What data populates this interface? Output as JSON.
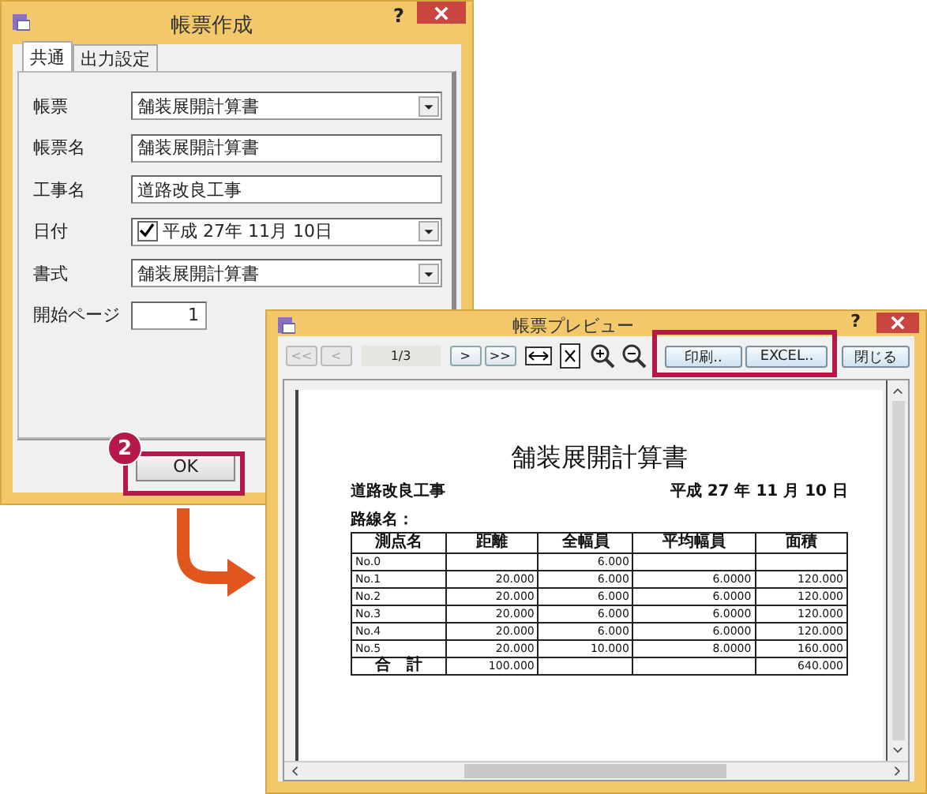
{
  "dialog": {
    "title": "帳票作成",
    "help": "?",
    "tabs": [
      {
        "label": "共通",
        "selected": true
      },
      {
        "label": "出力設定",
        "selected": false
      }
    ],
    "fields": [
      {
        "label": "帳票",
        "kind": "dropdown",
        "value": "舗装展開計算書"
      },
      {
        "label": "帳票名",
        "kind": "text",
        "value": "舗装展開計算書"
      },
      {
        "label": "工事名",
        "kind": "text",
        "value": "道路改良工事"
      },
      {
        "label": "日付",
        "kind": "date",
        "value": "平成 27年 11月 10日",
        "checked": true
      },
      {
        "label": "書式",
        "kind": "dropdown",
        "value": "舗装展開計算書"
      },
      {
        "label": "開始ページ",
        "kind": "number",
        "value": "1"
      }
    ],
    "ok_button": "OK",
    "step_badge": "2"
  },
  "preview": {
    "title": "帳票プレビュー",
    "help": "?",
    "nav_back": [
      {
        "label": "<<",
        "disabled": true
      },
      {
        "label": "<",
        "disabled": true
      }
    ],
    "page": "1/3",
    "nav_forward": [
      {
        "label": ">",
        "disabled": false
      },
      {
        "label": ">>",
        "disabled": false
      }
    ],
    "tools": [
      {
        "kind": "fit-width"
      },
      {
        "kind": "fit-page"
      },
      {
        "kind": "zoom-in"
      },
      {
        "kind": "zoom-out"
      }
    ],
    "action_buttons": [
      "印刷..",
      "EXCEL.."
    ],
    "close_button": "閉じる",
    "report": {
      "title": "舗装展開計算書",
      "project": "道路改良工事",
      "date": "平成 27 年 11 月 10 日",
      "route_label": "路線名：",
      "columns": [
        "測点名",
        "距離",
        "全幅員",
        "平均幅員",
        "面積"
      ],
      "rows": [
        [
          "No.0",
          null,
          "6.000",
          null,
          null
        ],
        [
          "No.1",
          "20.000",
          "6.000",
          "6.0000",
          "120.000"
        ],
        [
          "No.2",
          "20.000",
          "6.000",
          "6.0000",
          "120.000"
        ],
        [
          "No.3",
          "20.000",
          "6.000",
          "6.0000",
          "120.000"
        ],
        [
          "No.4",
          "20.000",
          "6.000",
          "6.0000",
          "120.000"
        ],
        [
          "No.5",
          "20.000",
          "10.000",
          "8.0000",
          "160.000"
        ]
      ],
      "total": {
        "label": "合　計",
        "distance": "100.000",
        "area": "640.000"
      }
    }
  }
}
